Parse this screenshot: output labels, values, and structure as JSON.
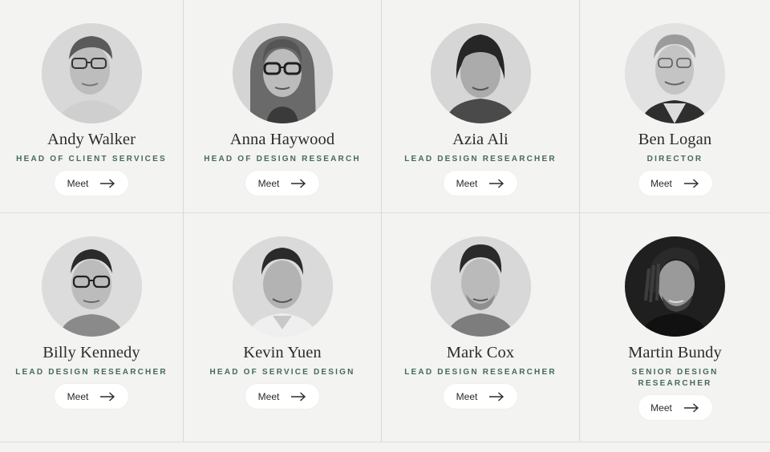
{
  "team": [
    {
      "name": "Andy Walker",
      "role": "HEAD OF CLIENT SERVICES",
      "meet_label": "Meet"
    },
    {
      "name": "Anna Haywood",
      "role": "HEAD OF DESIGN RESEARCH",
      "meet_label": "Meet"
    },
    {
      "name": "Azia Ali",
      "role": "LEAD DESIGN RESEARCHER",
      "meet_label": "Meet"
    },
    {
      "name": "Ben Logan",
      "role": "DIRECTOR",
      "meet_label": "Meet"
    },
    {
      "name": "Billy Kennedy",
      "role": "LEAD DESIGN RESEARCHER",
      "meet_label": "Meet"
    },
    {
      "name": "Kevin Yuen",
      "role": "HEAD OF SERVICE DESIGN",
      "meet_label": "Meet"
    },
    {
      "name": "Mark Cox",
      "role": "LEAD DESIGN RESEARCHER",
      "meet_label": "Meet"
    },
    {
      "name": "Martin Bundy",
      "role": "SENIOR DESIGN RESEARCHER",
      "meet_label": "Meet"
    }
  ],
  "colors": {
    "background": "#f3f3f1",
    "role_text": "#466a5a",
    "name_text": "#2c2c2c",
    "button_bg": "#ffffff"
  },
  "icons": {
    "meet_arrow": "arrow-right-icon"
  }
}
